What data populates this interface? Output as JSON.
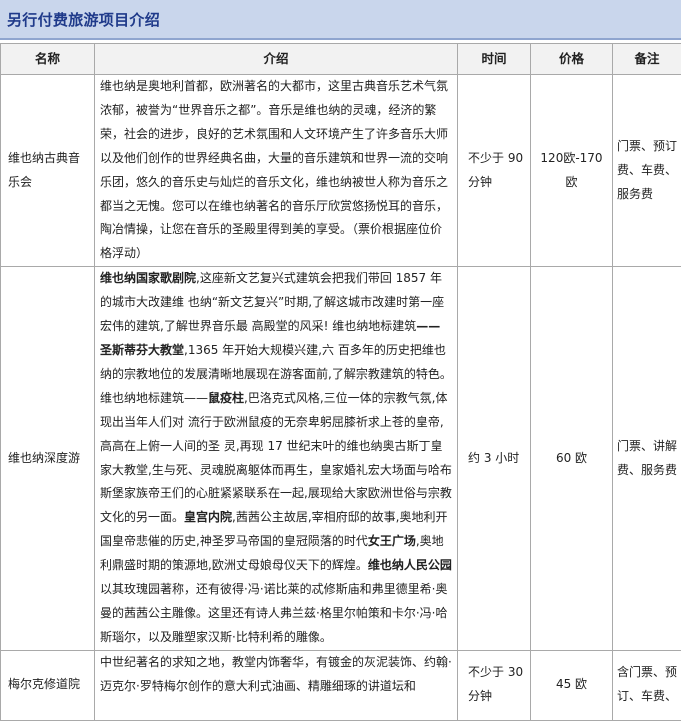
{
  "title": "另行付费旅游项目介绍",
  "headers": {
    "name": "名称",
    "desc": "介绍",
    "time": "时间",
    "price": "价格",
    "note": "备注"
  },
  "rows": [
    {
      "name": "维也纳古典音乐会",
      "desc": [
        {
          "t": "维也纳是奥地利首都，欧洲著名的大都市，这里古典音乐艺术气氛浓郁，被誉为“世界音乐之都”。音乐是维也纳的灵魂，经济的繁荣，社会的进步，良好的艺术氛围和人文环境产生了许多音乐大师以及他们创作的世界经典名曲，大量的音乐建筑和世界一流的交响乐团，悠久的音乐史与灿烂的音乐文化，维也纳被世人称为音乐之都当之无愧。您可以在维也纳著名的音乐厅欣赏悠扬悦耳的音乐，陶冶情操，让您在音乐的圣殿里得到美的享受。（票价根据座位价格浮动）",
          "b": false
        }
      ],
      "time": "不少于 90 分钟",
      "price": "120欧-170欧",
      "note": "门票、预订费、车费、服务费"
    },
    {
      "name": "维也纳深度游",
      "desc": [
        {
          "t": "维也纳国家歌剧院",
          "b": true
        },
        {
          "t": ",这座新文艺复兴式建筑会把我们带回 1857 年的城市大改建维 也纳“新文艺复兴”时期,了解这城市改建时第一座宏伟的建筑,了解世界音乐最 高殿堂的风采! 维也纳地标建筑",
          "b": false
        },
        {
          "t": "——圣斯蒂芬大教堂",
          "b": true
        },
        {
          "t": ",1365 年开始大规模兴建,六 百多年的历史把维也纳的宗教地位的发展清晰地展现在游客面前,了解宗教建筑的特色。维也纳地标建筑——",
          "b": false
        },
        {
          "t": "鼠疫柱",
          "b": true
        },
        {
          "t": ",巴洛克式风格,三位一体的宗教气氛,体现出当年人们对 流行于欧洲鼠疫的无奈卑躬屈膝祈求上苍的皇帝,高高在上俯一人间的圣 灵,再现 17 世纪末叶的维也纳奥古斯丁皇家大教堂,生与死、灵魂脱离躯体而再生，皇家婚礼宏大场面与哈布斯堡家族帝王们的心脏紧紧联系在一起,展现给大家欧洲世俗与宗教文化的另一面。",
          "b": false
        },
        {
          "t": "皇宫内院",
          "b": true
        },
        {
          "t": ",茜茜公主故居,宰相府邸的故事,奥地利开国皇帝悲催的历史,神圣罗马帝国的皇冠陨落的时代",
          "b": false
        },
        {
          "t": "女王广场",
          "b": true
        },
        {
          "t": ",奥地利鼎盛时期的策源地,欧洲丈母娘母仪天下的辉煌。",
          "b": false
        },
        {
          "t": "维也纳人民公园",
          "b": true
        },
        {
          "t": "以其玫瑰园著称，还有彼得·冯·诺比莱的忒修斯庙和弗里德里希·奥曼的茜茜公主雕像。这里还有诗人弗兰兹·格里尔帕策和卡尔·冯·哈斯瑙尔，以及雕塑家汉斯·比特利希的雕像。",
          "b": false
        }
      ],
      "time": "约 3 小时",
      "price": "60 欧",
      "note": "门票、讲解费、服务费"
    },
    {
      "name": "梅尔克修道院",
      "desc": [
        {
          "t": "中世纪著名的求知之地，教堂内饰奢华，有镀金的灰泥装饰、约翰·迈克尔·罗特梅尔创作的意大利式油画、精雕细琢的讲道坛和",
          "b": false
        }
      ],
      "time": "不少于 30 分钟",
      "price": "45 欧",
      "note": "含门票、预订、车费、"
    }
  ]
}
